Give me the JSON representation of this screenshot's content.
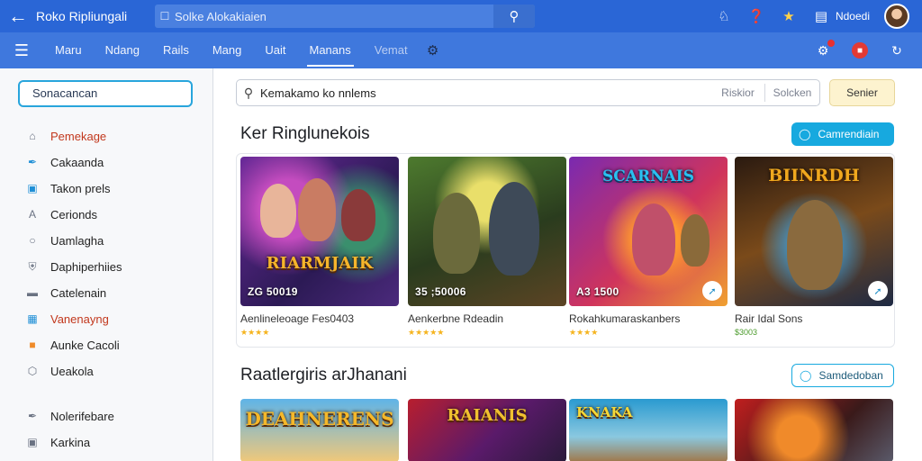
{
  "topbar": {
    "app_title": "Roko Ripliungali",
    "search_text": "Solke Alokakiaien",
    "user_name": "Ndoedi"
  },
  "navbar": {
    "tabs": [
      "Maru",
      "Ndang",
      "Rails",
      "Mang",
      "Uait",
      "Manans",
      "Vemat"
    ],
    "active_index": 5
  },
  "sidebar": {
    "search_label": "Sonacancan",
    "items": [
      {
        "label": "Pemekage",
        "icon": "home-icon"
      },
      {
        "label": "Cakaanda",
        "icon": "feather-icon"
      },
      {
        "label": "Takon prels",
        "icon": "badge-icon"
      },
      {
        "label": "Cerionds",
        "icon": "letter-a-icon"
      },
      {
        "label": "Uamlagha",
        "icon": "circle-icon"
      },
      {
        "label": "Daphiperhiies",
        "icon": "shield-icon"
      },
      {
        "label": "Catelenain",
        "icon": "monitor-icon"
      },
      {
        "label": "Vanenayng",
        "icon": "calendar-icon"
      },
      {
        "label": "Aunke Cacoli",
        "icon": "tag-icon"
      },
      {
        "label": "Ueakola",
        "icon": "gem-icon"
      },
      {
        "label": "Nolerifebare",
        "icon": "bookmark-icon"
      },
      {
        "label": "Karkina",
        "icon": "image-icon"
      }
    ]
  },
  "main": {
    "search_text": "Kemakamo ko nnlems",
    "filter_1": "Riskior",
    "filter_2": "Solcken",
    "search_button": "Senier",
    "section_1": {
      "title": "Ker Ringlunekois",
      "action": "Camrendiain",
      "cards": [
        {
          "logo": "RIARMJAIK",
          "price": "ZG 50019",
          "title": "Aenlineleoage Fes0403",
          "rating": "★★★★"
        },
        {
          "logo": "",
          "price": "35 ;50006",
          "title": "Aenkerbne Rdeadin",
          "rating": "★★★★★"
        },
        {
          "logo": "SCARNAIS",
          "price": "A3 1500",
          "title": "Rokahkumaraskanbers",
          "rating": "★★★★"
        },
        {
          "logo": "BIINRDH",
          "price": "",
          "title": "Rair Idal Sons",
          "rating": "$3003"
        }
      ]
    },
    "section_2": {
      "title": "Raatlergiris arJhanani",
      "action": "Samdedoban",
      "cards": [
        {
          "logo": "DEAHNERENS"
        },
        {
          "logo": "RAIANIS"
        },
        {
          "logo": "KNAKA"
        },
        {
          "logo": ""
        }
      ]
    }
  }
}
